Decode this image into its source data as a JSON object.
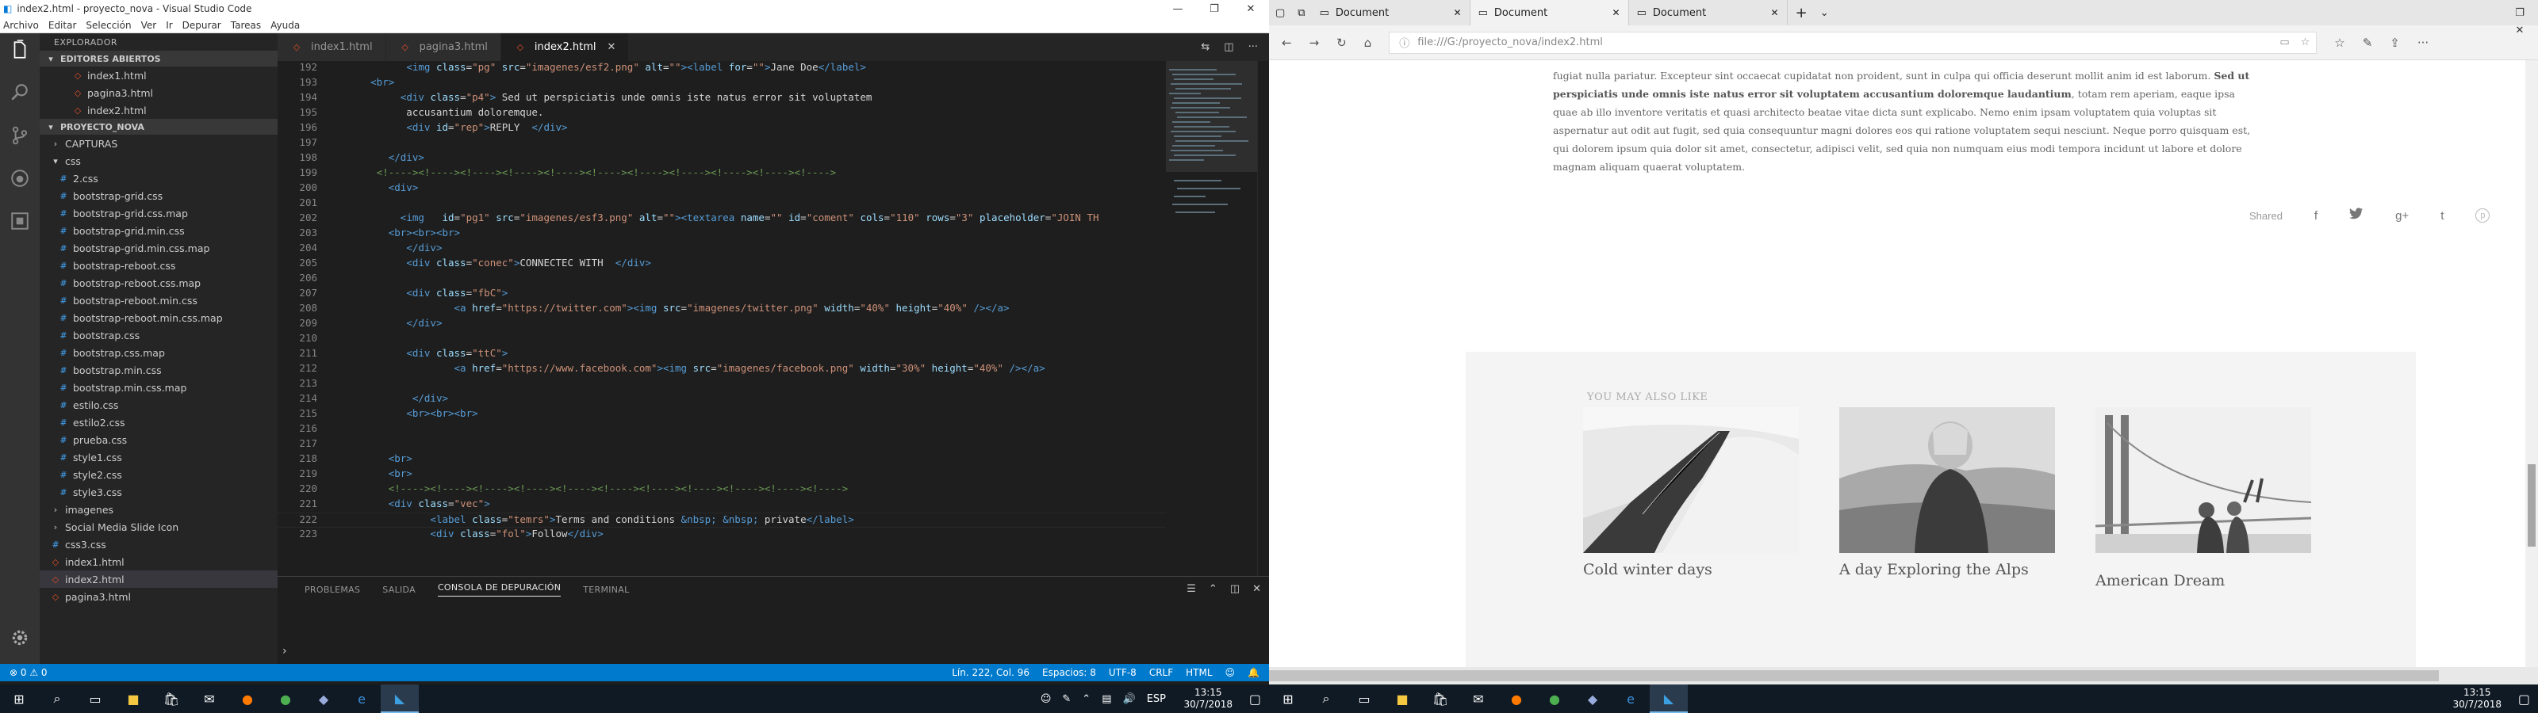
{
  "vscode": {
    "title": "index2.html - proyecto_nova - Visual Studio Code",
    "menu": [
      "Archivo",
      "Editar",
      "Selección",
      "Ver",
      "Ir",
      "Depurar",
      "Tareas",
      "Ayuda"
    ],
    "explorer_header": "EXPLORADOR",
    "open_editors_title": "EDITORES ABIERTOS",
    "open_editors": [
      "index1.html",
      "pagina3.html",
      "index2.html"
    ],
    "project_title": "PROYECTO_NOVA",
    "tree": [
      {
        "label": "CAPTURAS",
        "type": "folder",
        "indent": 1,
        "open": false
      },
      {
        "label": "css",
        "type": "folder",
        "indent": 1,
        "open": true
      },
      {
        "label": "2.css",
        "type": "css",
        "indent": 2
      },
      {
        "label": "bootstrap-grid.css",
        "type": "css",
        "indent": 2
      },
      {
        "label": "bootstrap-grid.css.map",
        "type": "map",
        "indent": 2
      },
      {
        "label": "bootstrap-grid.min.css",
        "type": "css",
        "indent": 2
      },
      {
        "label": "bootstrap-grid.min.css.map",
        "type": "map",
        "indent": 2
      },
      {
        "label": "bootstrap-reboot.css",
        "type": "css",
        "indent": 2
      },
      {
        "label": "bootstrap-reboot.css.map",
        "type": "map",
        "indent": 2
      },
      {
        "label": "bootstrap-reboot.min.css",
        "type": "css",
        "indent": 2
      },
      {
        "label": "bootstrap-reboot.min.css.map",
        "type": "map",
        "indent": 2
      },
      {
        "label": "bootstrap.css",
        "type": "css",
        "indent": 2
      },
      {
        "label": "bootstrap.css.map",
        "type": "map",
        "indent": 2
      },
      {
        "label": "bootstrap.min.css",
        "type": "css",
        "indent": 2
      },
      {
        "label": "bootstrap.min.css.map",
        "type": "map",
        "indent": 2
      },
      {
        "label": "estilo.css",
        "type": "css",
        "indent": 2
      },
      {
        "label": "estilo2.css",
        "type": "css",
        "indent": 2
      },
      {
        "label": "prueba.css",
        "type": "css",
        "indent": 2
      },
      {
        "label": "style1.css",
        "type": "css",
        "indent": 2
      },
      {
        "label": "style2.css",
        "type": "css",
        "indent": 2
      },
      {
        "label": "style3.css",
        "type": "css",
        "indent": 2
      },
      {
        "label": "imagenes",
        "type": "folder",
        "indent": 1,
        "open": false
      },
      {
        "label": "Social Media Slide Icon",
        "type": "folder",
        "indent": 1,
        "open": false
      },
      {
        "label": "css3.css",
        "type": "css",
        "indent": 1
      },
      {
        "label": "index1.html",
        "type": "html",
        "indent": 1
      },
      {
        "label": "index2.html",
        "type": "html",
        "indent": 1,
        "selected": true
      },
      {
        "label": "pagina3.html",
        "type": "html",
        "indent": 1
      }
    ],
    "tabs": [
      {
        "label": "index1.html"
      },
      {
        "label": "pagina3.html"
      },
      {
        "label": "index2.html",
        "active": true
      }
    ],
    "code": [
      {
        "n": "192",
        "h": "            <span class=tg>&lt;img</span> <span class=at>class</span>=<span class=st>\"pg\"</span> <span class=at>src</span>=<span class=st>\"imagenes/esf2.png\"</span> <span class=at>alt</span>=<span class=st>\"\"</span><span class=tg>&gt;&lt;label</span> <span class=at>for</span>=<span class=st>\"\"</span><span class=tg>&gt;</span>Jane Doe<span class=tg>&lt;/label&gt;</span>"
      },
      {
        "n": "193",
        "h": "      <span class=tg>&lt;br&gt;</span>"
      },
      {
        "n": "194",
        "h": "           <span class=tg>&lt;div</span> <span class=at>class</span>=<span class=st>\"p4\"</span><span class=tg>&gt;</span> Sed ut perspiciatis unde omnis iste natus error sit voluptatem"
      },
      {
        "n": "195",
        "h": "            accusantium doloremque."
      },
      {
        "n": "196",
        "h": "            <span class=tg>&lt;div</span> <span class=at>id</span>=<span class=st>\"rep\"</span><span class=tg>&gt;</span>REPLY  <span class=tg>&lt;/div&gt;</span>"
      },
      {
        "n": "197",
        "h": ""
      },
      {
        "n": "198",
        "h": "         <span class=tg>&lt;/div&gt;</span>"
      },
      {
        "n": "199",
        "h": "       <span class=cm>&lt;!----&gt;&lt;!----&gt;&lt;!----&gt;&lt;!----&gt;&lt;!----&gt;&lt;!----&gt;&lt;!----&gt;&lt;!----&gt;&lt;!----&gt;&lt;!----&gt;&lt;!----&gt;</span>"
      },
      {
        "n": "200",
        "h": "         <span class=tg>&lt;div&gt;</span>"
      },
      {
        "n": "201",
        "h": ""
      },
      {
        "n": "202",
        "h": "           <span class=tg>&lt;img</span>   <span class=at>id</span>=<span class=st>\"pg1\"</span> <span class=at>src</span>=<span class=st>\"imagenes/esf3.png\"</span> <span class=at>alt</span>=<span class=st>\"\"</span><span class=tg>&gt;&lt;textarea</span> <span class=at>name</span>=<span class=st>\"\"</span> <span class=at>id</span>=<span class=st>\"coment\"</span> <span class=at>cols</span>=<span class=st>\"110\"</span> <span class=at>rows</span>=<span class=st>\"3\"</span> <span class=at>placeholder</span>=<span class=st>\"JOIN TH</span>"
      },
      {
        "n": "203",
        "h": "         <span class=tg>&lt;br&gt;&lt;br&gt;&lt;br&gt;</span>"
      },
      {
        "n": "204",
        "h": "            <span class=tg>&lt;/div&gt;</span>"
      },
      {
        "n": "205",
        "h": "            <span class=tg>&lt;div</span> <span class=at>class</span>=<span class=st>\"conec\"</span><span class=tg>&gt;</span>CONNECTEC WITH  <span class=tg>&lt;/div&gt;</span>"
      },
      {
        "n": "206",
        "h": ""
      },
      {
        "n": "207",
        "h": "            <span class=tg>&lt;div</span> <span class=at>class</span>=<span class=st>\"fbC\"</span><span class=tg>&gt;</span>"
      },
      {
        "n": "208",
        "h": "                    <span class=tg>&lt;a</span> <span class=at>href</span>=<span class=st>\"https://twitter.com\"</span><span class=tg>&gt;&lt;img</span> <span class=at>src</span>=<span class=st>\"imagenes/twitter.png\"</span> <span class=at>width</span>=<span class=st>\"40%\"</span> <span class=at>height</span>=<span class=st>\"40%\"</span> <span class=tg>/&gt;&lt;/a&gt;</span>"
      },
      {
        "n": "209",
        "h": "            <span class=tg>&lt;/div&gt;</span>"
      },
      {
        "n": "210",
        "h": ""
      },
      {
        "n": "211",
        "h": "            <span class=tg>&lt;div</span> <span class=at>class</span>=<span class=st>\"ttC\"</span><span class=tg>&gt;</span>"
      },
      {
        "n": "212",
        "h": "                    <span class=tg>&lt;a</span> <span class=at>href</span>=<span class=st>\"https://www.facebook.com\"</span><span class=tg>&gt;&lt;img</span> <span class=at>src</span>=<span class=st>\"imagenes/facebook.png\"</span> <span class=at>width</span>=<span class=st>\"30%\"</span> <span class=at>height</span>=<span class=st>\"40%\"</span> <span class=tg>/&gt;&lt;/a&gt;</span>"
      },
      {
        "n": "213",
        "h": ""
      },
      {
        "n": "214",
        "h": "             <span class=tg>&lt;/div&gt;</span>"
      },
      {
        "n": "215",
        "h": "            <span class=tg>&lt;br&gt;&lt;br&gt;&lt;br&gt;</span>"
      },
      {
        "n": "216",
        "h": ""
      },
      {
        "n": "217",
        "h": ""
      },
      {
        "n": "218",
        "h": "         <span class=tg>&lt;br&gt;</span>"
      },
      {
        "n": "219",
        "h": "         <span class=tg>&lt;br&gt;</span>"
      },
      {
        "n": "220",
        "h": "         <span class=cm>&lt;!----&gt;&lt;!----&gt;&lt;!----&gt;&lt;!----&gt;&lt;!----&gt;&lt;!----&gt;&lt;!----&gt;&lt;!----&gt;&lt;!----&gt;&lt;!----&gt;&lt;!----&gt;</span>"
      },
      {
        "n": "221",
        "h": "         <span class=tg>&lt;div</span> <span class=at>class</span>=<span class=st>\"vec\"</span><span class=tg>&gt;</span>"
      },
      {
        "n": "222",
        "h": "                <span class=tg>&lt;label</span> <span class=at>class</span>=<span class=st>\"temrs\"</span><span class=tg>&gt;</span>Terms and conditions <span class=ent>&amp;nbsp;</span> <span class=ent>&amp;nbsp;</span> private<span class=tg>&lt;/label&gt;</span>",
        "cur": true
      },
      {
        "n": "223",
        "h": "                <span class=tg>&lt;div</span> <span class=at>class</span>=<span class=st>\"fol\"</span><span class=tg>&gt;</span>Follow<span class=tg>&lt;/div&gt;</span>"
      }
    ],
    "panel_tabs": [
      "PROBLEMAS",
      "SALIDA",
      "CONSOLA DE DEPURACIÓN",
      "TERMINAL"
    ],
    "panel_active": "CONSOLA DE DEPURACIÓN",
    "prompt": "›",
    "status_left": "⊗ 0  ⚠ 0",
    "status_right": [
      "Lín. 222, Col. 96",
      "Espacios: 8",
      "UTF-8",
      "CRLF",
      "HTML",
      "☺",
      "🔔"
    ]
  },
  "edge": {
    "tabs": [
      {
        "label": "Document"
      },
      {
        "label": "Document",
        "active": true
      },
      {
        "label": "Document"
      }
    ],
    "url": "file:///G:/proyecto_nova/index2.html",
    "paragraph_html": "fugiat nulla pariatur. Excepteur sint occaecat cupidatat non proident, sunt in culpa qui officia deserunt mollit anim id est laborum. <b>Sed ut perspiciatis unde omnis iste natus error sit voluptatem accusantium doloremque laudantium</b>, totam rem aperiam, eaque ipsa quae ab illo inventore veritatis et quasi architecto beatae vitae dicta sunt explicabo. Nemo enim ipsam voluptatem quia voluptas sit aspernatur aut odit aut fugit, sed quia consequuntur magni dolores eos qui ratione voluptatem sequi nesciunt. Neque porro quisquam est, qui dolorem ipsum quia dolor sit amet, consectetur, adipisci velit, sed quia non numquam eius modi tempora incidunt ut labore et dolore magnam aliquam quaerat voluptatem.",
    "shared_label": "Shared",
    "share_icons": [
      "f",
      "t",
      "g+",
      "t",
      "p"
    ],
    "also_title": "YOU MAY ALSO LIKE",
    "cards": [
      {
        "caption": "Cold winter days"
      },
      {
        "caption": "A day Exploring the Alps"
      },
      {
        "caption": "American Dream"
      }
    ]
  },
  "taskbar": {
    "time": "13:15",
    "date": "30/7/2018",
    "lang": "ESP"
  }
}
